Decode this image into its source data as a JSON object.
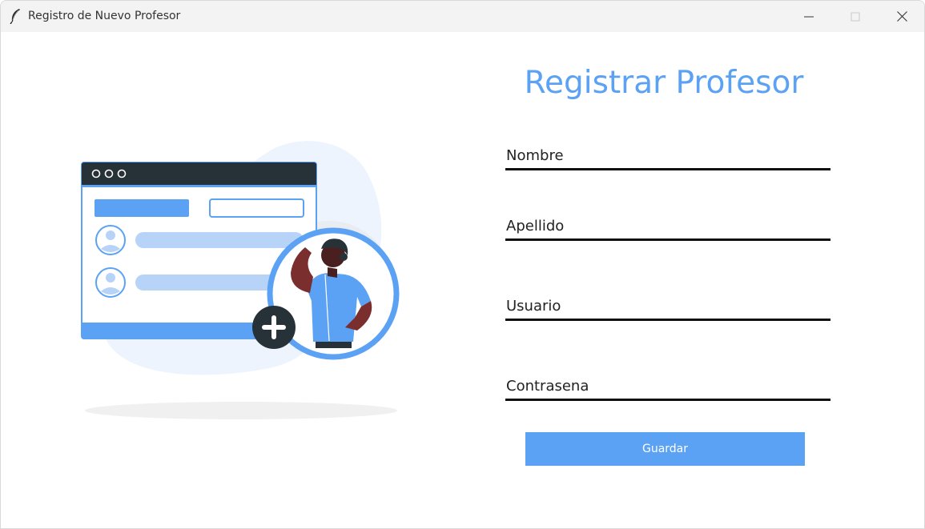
{
  "window": {
    "title": "Registro de Nuevo Profesor",
    "controls": {
      "minimize": "minimize-icon",
      "maximize": "maximize-icon",
      "close": "close-icon"
    }
  },
  "form": {
    "heading": "Registrar Profesor",
    "fields": [
      {
        "name": "nombre",
        "placeholder": "Nombre",
        "value": ""
      },
      {
        "name": "apellido",
        "placeholder": "Apellido",
        "value": ""
      },
      {
        "name": "usuario",
        "placeholder": "Usuario",
        "value": ""
      },
      {
        "name": "contrasena",
        "placeholder": "Contrasena",
        "value": ""
      }
    ],
    "save_label": "Guardar"
  },
  "colors": {
    "accent": "#5ba2f5",
    "titlebar": "#f3f3f3",
    "underline": "#111111",
    "illustration_dark": "#263238",
    "illustration_light": "#b7d3f7"
  }
}
